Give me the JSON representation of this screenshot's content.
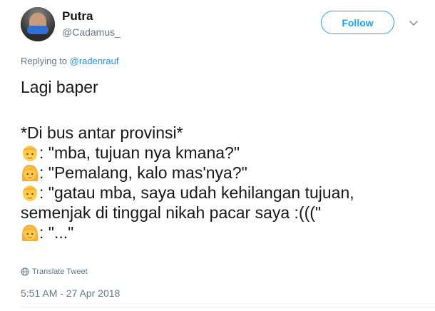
{
  "author": {
    "display_name": "Putra",
    "handle": "@Cadamus_"
  },
  "actions": {
    "follow_label": "Follow",
    "more_icon": "chevron-down-icon"
  },
  "reply_context": {
    "prefix": "Replying to ",
    "mention": "@radenrauf"
  },
  "tweet": {
    "lines": [
      "Lagi baper",
      "*Di bus antar provinsi*",
      ": \"mba, tujuan nya kmana?\"",
      ": \"Pemalang, kalo mas'nya?\"",
      ": \"gatau mba, saya udah kehilangan tujuan,",
      "semenjak di tinggal nikah pacar saya :(((\"",
      ": \"...\""
    ],
    "emoji_icons": [
      "man-emoji-icon",
      "woman-emoji-icon",
      "man-emoji-icon",
      "woman-emoji-icon"
    ]
  },
  "translate_label": "Translate Tweet",
  "timestamp": "5:51 AM - 27 Apr 2018",
  "colors": {
    "accent": "#1da1f2",
    "mention": "#1b95e0",
    "muted": "#657786",
    "text": "#14171a",
    "emoji_skin": "#ffcc4d",
    "emoji_hair": "#ffac33"
  }
}
